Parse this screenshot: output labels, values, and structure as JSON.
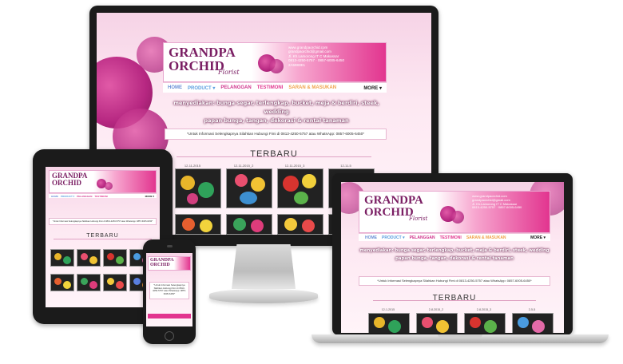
{
  "site": {
    "logo_title_1": "GRANDPA",
    "logo_title_2": "ORCHID",
    "logo_sub": "Florist",
    "contact": [
      "www.grandpaorchid.com",
      "grandpaorchid@gmail.com",
      "Jl. Kh.Lamorong IT C Makassar",
      "0813-4250-5757 · 0857-6005-6450",
      "2A5983E1"
    ],
    "nav": [
      "HOME",
      "PRODUCT ▾",
      "PELANGGAN",
      "TESTIMONI",
      "SARAN & MASUKAN",
      "MORE ▾"
    ],
    "tagline_1": "menyediakan: bunga segar, terlengkap, bucket, meja & berdiri, steek, wedding",
    "tagline_2": "papan bunga, tangan, dekorasi & rental tanaman",
    "info": "*Untuk Informasi Selengkapnya Silahkan Hubungi Fimi di 0813-4250-5757 atau WhatsApp: 0857-6005-6450*",
    "section_title": "TERBARU",
    "captions": [
      "12-11-2015",
      "12-11-2015_2",
      "12-11-2015_3",
      "12-11-5"
    ],
    "captions_laptop": [
      "12-1-2015",
      "2-8-2015_2",
      "2-8-2015_3",
      "2-5-5"
    ]
  },
  "colors": {
    "brand": "#7a1e63",
    "accent": "#e2358f",
    "nav_home": "#6b8fd6",
    "nav_product": "#5fa0e0",
    "nav_pelanggan": "#d0358d",
    "nav_testimoni": "#e2368f",
    "nav_saran": "#f0a24a",
    "nav_more": "#222222"
  }
}
